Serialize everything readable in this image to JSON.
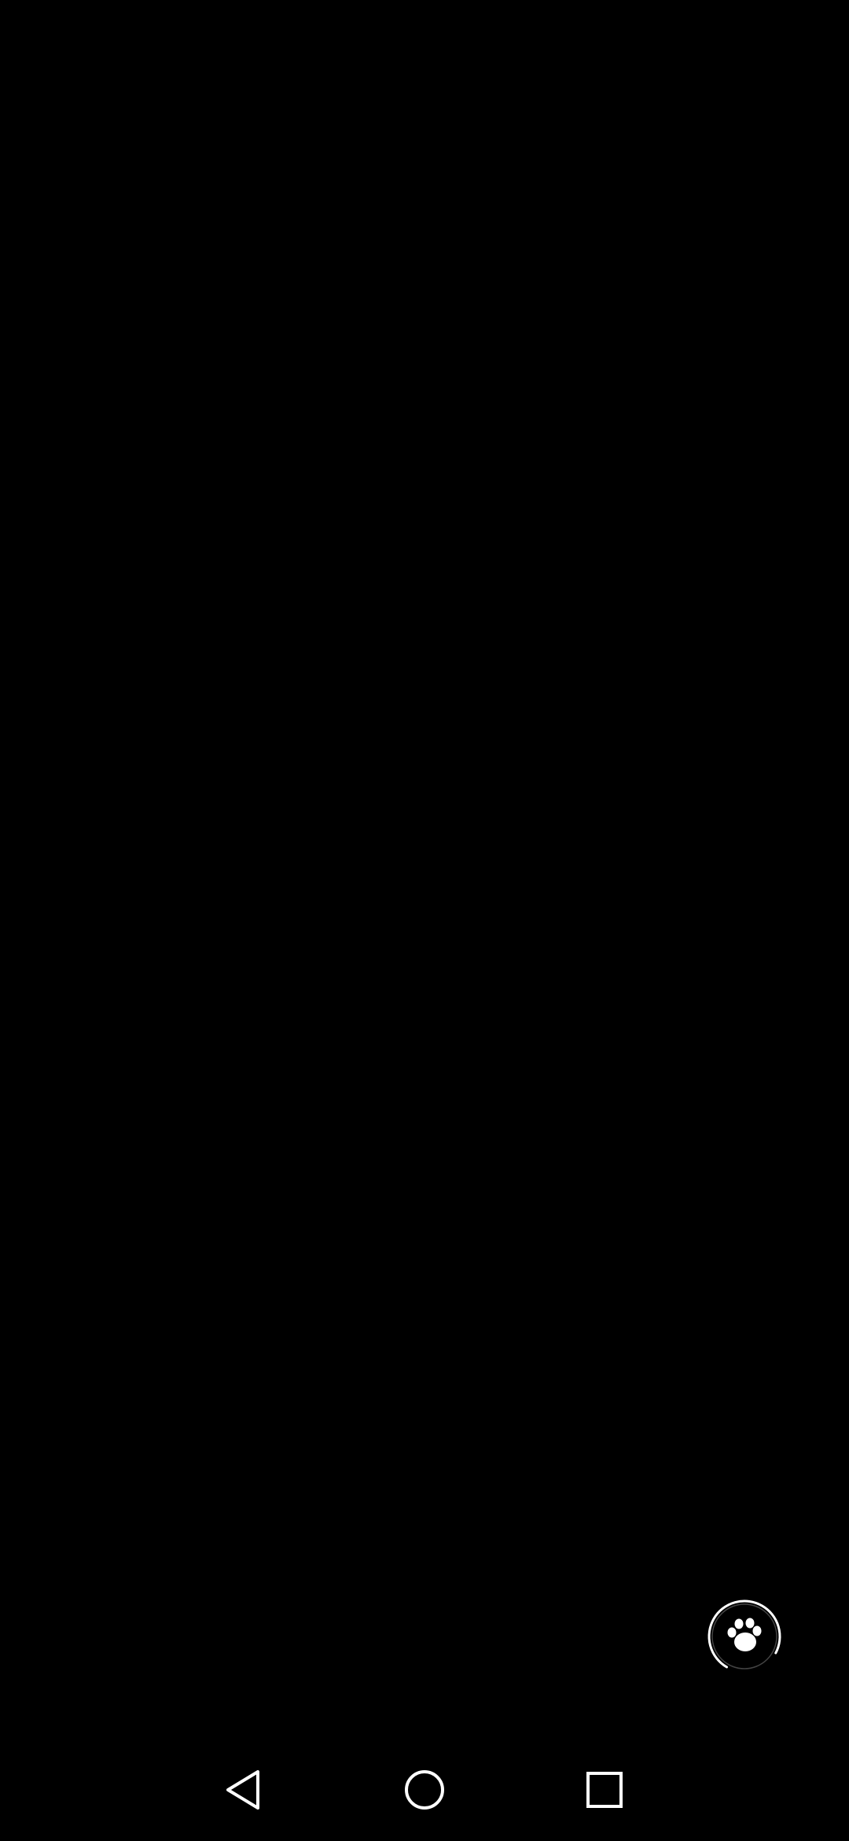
{
  "screen": {
    "background_color": "#000000"
  },
  "fab": {
    "icon": "paw-icon",
    "state": "loading",
    "icon_color": "#ffffff",
    "ring_color": "#ffffff"
  },
  "navigation_bar": {
    "buttons": [
      {
        "name": "back",
        "icon": "back-triangle-icon"
      },
      {
        "name": "home",
        "icon": "home-circle-icon"
      },
      {
        "name": "recents",
        "icon": "recents-square-icon"
      }
    ],
    "icon_color": "#ffffff"
  }
}
